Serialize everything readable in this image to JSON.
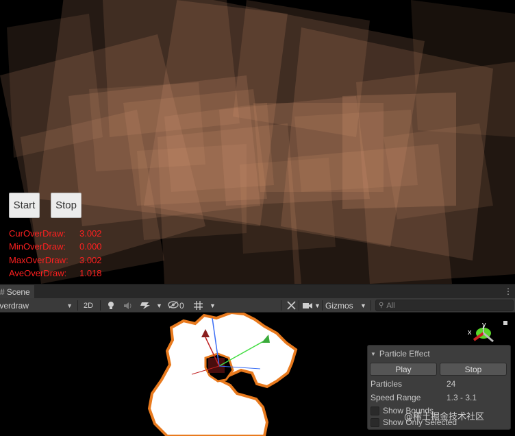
{
  "game": {
    "start_label": "Start",
    "stop_label": "Stop",
    "stats": [
      {
        "label": "CurOverDraw:",
        "value": "3.002"
      },
      {
        "label": "MinOverDraw:",
        "value": "0.000"
      },
      {
        "label": "MaxOverDraw:",
        "value": "3.002"
      },
      {
        "label": "AveOverDraw:",
        "value": "1.018"
      }
    ],
    "stat_color": "#ff2020"
  },
  "scene_tab": {
    "label": "Scene",
    "icon": "grid-hash-icon",
    "menu_icon": "kebab-menu-icon"
  },
  "toolbar": {
    "draw_mode": "Overdraw",
    "mode_2d": "2D",
    "hidden_count": "0",
    "gizmos_label": "Gizmos",
    "search_placeholder": "All"
  },
  "gizmo": {
    "y_label": "y",
    "x_label": "x"
  },
  "particle_effect": {
    "title": "Particle Effect",
    "play_label": "Play",
    "stop_label": "Stop",
    "rows": [
      {
        "label": "Particles",
        "value": "24"
      },
      {
        "label": "Speed Range",
        "value": "1.3 - 3.1"
      }
    ],
    "checks": [
      "Show Bounds",
      "Show Only Selected"
    ]
  },
  "watermark": "@稀土掘金技术社区"
}
